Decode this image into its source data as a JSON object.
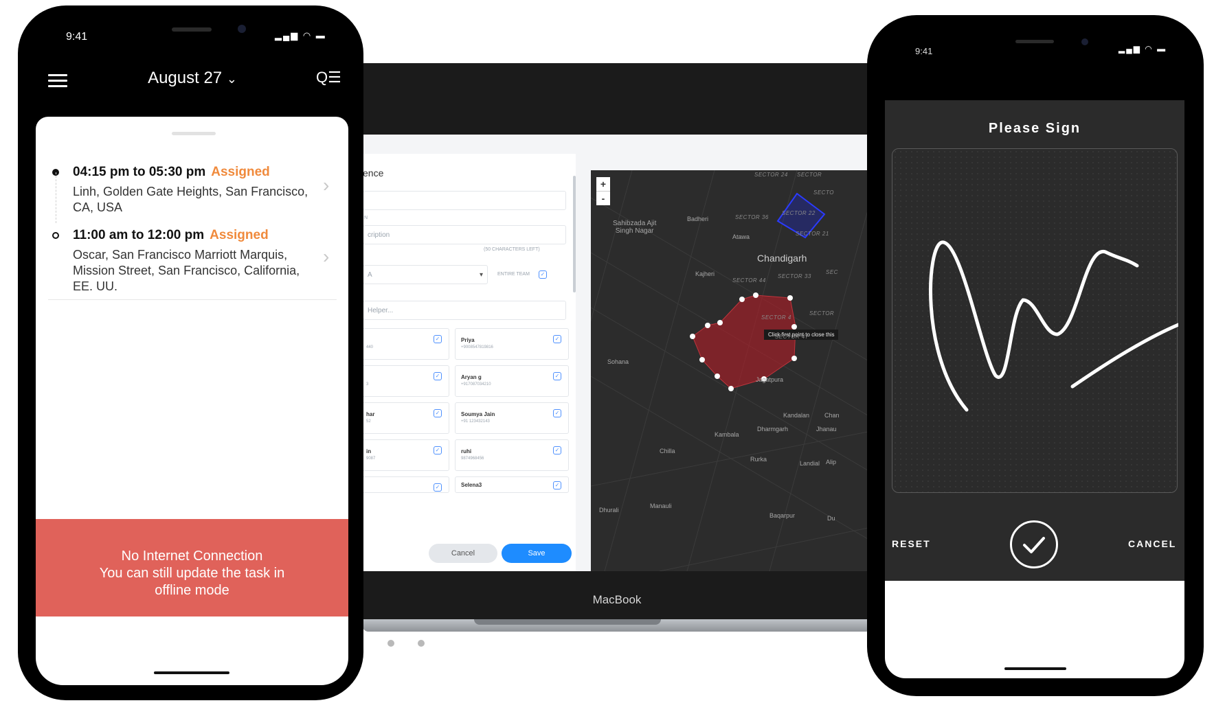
{
  "laptop": {
    "brand": "MacBook",
    "form_title": "ence",
    "field_labels": [
      "N",
      "(50 CHARACTERS LEFT)",
      "ENTIRE TEAM"
    ],
    "description_placeholder": "cription",
    "team_select_value": "A",
    "helper_placeholder": "Helper...",
    "members_left": [
      {
        "name": "",
        "phone": "440"
      },
      {
        "name": "",
        "phone": "3"
      },
      {
        "name": "har",
        "phone": "52"
      },
      {
        "name": "in",
        "phone": "9087"
      },
      {
        "name": "",
        "phone": ""
      }
    ],
    "members_right": [
      {
        "name": "Priya",
        "phone": "+9008547819816"
      },
      {
        "name": "Aryan g",
        "phone": "+917087034210"
      },
      {
        "name": "Soumya Jain",
        "phone": "+91 123432143"
      },
      {
        "name": "ruhi",
        "phone": "9874968456"
      },
      {
        "name": "Selena3",
        "phone": ""
      }
    ],
    "cancel_label": "Cancel",
    "save_label": "Save",
    "map": {
      "zoom_in": "+",
      "zoom_out": "-",
      "tooltip": "Click first point to close this",
      "labels": {
        "sahibzada": "Sahibzada Ajit\nSingh Nagar",
        "badheri": "Badheri",
        "atawa": "Atawa",
        "chandigarh": "Chandigarh",
        "kajheri": "Kajheri",
        "sohana": "Sohana",
        "jagatpura": "Jagatpura",
        "kandalan": "Kandalan",
        "dharmgarh": "Dharmgarh",
        "kambala": "Kambala",
        "chilla": "Chilla",
        "rurka": "Rurka",
        "landial": "Landial",
        "dhurali": "Dhurali",
        "manauli": "Manauli",
        "baqarpur": "Baqarpur",
        "jhanau": "Jhanau",
        "chan": "Chan",
        "alip": "Alip",
        "du": "Du",
        "sector24": "SECTOR 24",
        "sector36": "SECTOR 36",
        "sector22": "SECTOR 22",
        "sector21": "SECTOR 21",
        "sector44": "SECTOR 44",
        "sector33": "SECTOR 33",
        "sector_a": "SECTOR",
        "sector_b": "SECTO",
        "sector_c": "SECTOR",
        "sector_d": "SEC",
        "sector47": "SECTOR 47",
        "sector_e": "SECTOR 4"
      }
    }
  },
  "left_phone": {
    "time": "9:41",
    "status_icons": "▂▄▆ ◠ ▬",
    "title": "August 27",
    "title_chevron": "⌄",
    "search_icon": "Q☰",
    "tasks": [
      {
        "time": "04:15 pm to 05:30 pm",
        "status": "Assigned",
        "address": "Linh, Golden Gate Heights, San Francisco, CA, USA"
      },
      {
        "time": "11:00 am to 12:00 pm",
        "status": "Assigned",
        "address": "Oscar, San Francisco Marriott Marquis, Mission Street, San Francisco, California, EE. UU."
      }
    ],
    "offline_line1": "No Internet Connection",
    "offline_line2": "You can still update the task in offline mode",
    "colors": {
      "accent": "#f08a3c",
      "offline_banner": "#e0625a"
    }
  },
  "right_phone": {
    "time": "9:41",
    "status_icons": "▂▄▆ ◠ ▬",
    "title": "Please Sign",
    "reset_label": "RESET",
    "cancel_label": "CANCEL"
  }
}
